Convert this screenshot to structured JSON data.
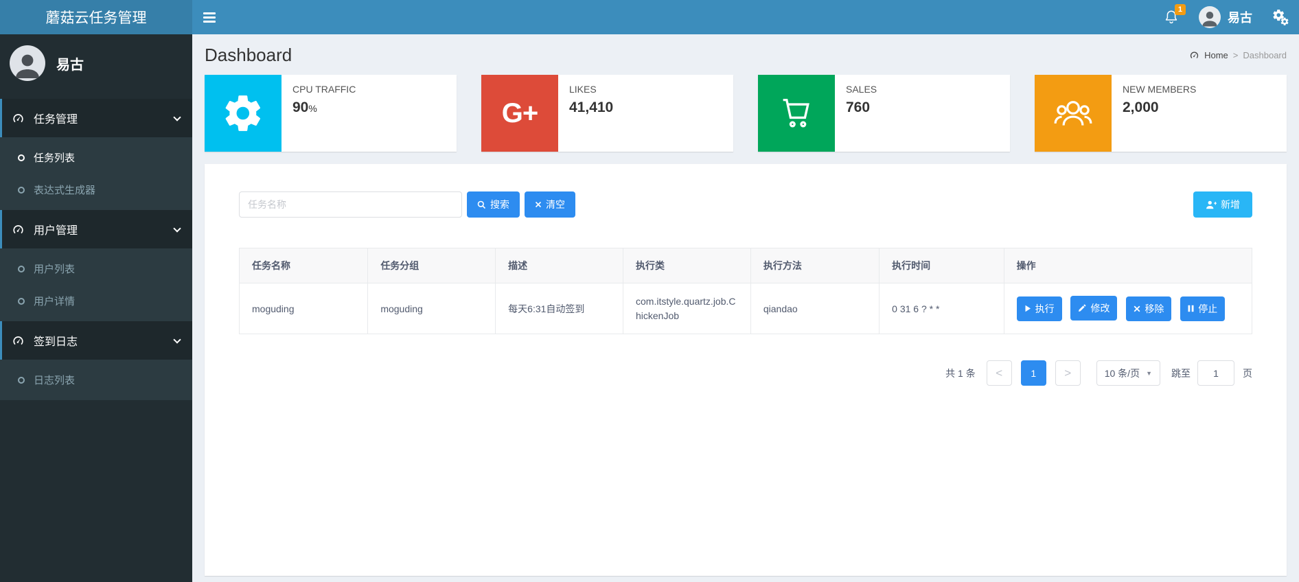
{
  "app": {
    "title": "蘑菇云任务管理"
  },
  "navbar": {
    "notification_count": "1",
    "user_name": "易古"
  },
  "sidebar": {
    "user_name": "易古",
    "menu": [
      {
        "label": "任务管理",
        "icon": "dashboard-icon",
        "children": [
          {
            "label": "任务列表",
            "active": true
          },
          {
            "label": "表达式生成器",
            "active": false
          }
        ]
      },
      {
        "label": "用户管理",
        "icon": "dashboard-icon",
        "children": [
          {
            "label": "用户列表",
            "active": false
          },
          {
            "label": "用户详情",
            "active": false
          }
        ]
      },
      {
        "label": "签到日志",
        "icon": "dashboard-icon",
        "children": [
          {
            "label": "日志列表",
            "active": false
          }
        ]
      }
    ]
  },
  "content": {
    "page_title": "Dashboard",
    "breadcrumb": {
      "home": "Home",
      "separator": ">",
      "current": "Dashboard"
    },
    "info_boxes": [
      {
        "label": "CPU TRAFFIC",
        "value": "90",
        "suffix": "%",
        "color": "#00c0ef",
        "icon": "gear-icon"
      },
      {
        "label": "LIKES",
        "value": "41,410",
        "suffix": "",
        "color": "#dd4b39",
        "icon": "google-plus-icon",
        "icon_text": "G+"
      },
      {
        "label": "SALES",
        "value": "760",
        "suffix": "",
        "color": "#00a65a",
        "icon": "cart-icon"
      },
      {
        "label": "NEW MEMBERS",
        "value": "2,000",
        "suffix": "",
        "color": "#f39c12",
        "icon": "users-icon"
      }
    ],
    "toolbar": {
      "search_placeholder": "任务名称",
      "search_label": "搜索",
      "clear_label": "清空",
      "add_label": "新增"
    },
    "table": {
      "headers": [
        "任务名称",
        "任务分组",
        "描述",
        "执行类",
        "执行方法",
        "执行时间",
        "操作"
      ],
      "rows": [
        {
          "name": "moguding",
          "group": "moguding",
          "desc": "每天6:31自动签到",
          "job_class": "com.itstyle.quartz.job.ChickenJob",
          "method": "qiandao",
          "cron": "0 31 6 ? * *",
          "actions": [
            "执行",
            "修改",
            "移除",
            "停止"
          ]
        }
      ]
    },
    "pagination": {
      "total": "共 1 条",
      "prev": "<",
      "page": "1",
      "next": ">",
      "page_size": "10 条/页",
      "caret": "▼",
      "jump_label": "跳至",
      "jump_value": "1",
      "page_unit": "页"
    }
  },
  "colors": {
    "navbar": "#3c8dbc",
    "logo_bg": "#367fa9",
    "sidebar_bg": "#222d32",
    "primary_button": "#2d8cf0",
    "add_button": "#29b6f6",
    "badge": "#f39c12"
  }
}
